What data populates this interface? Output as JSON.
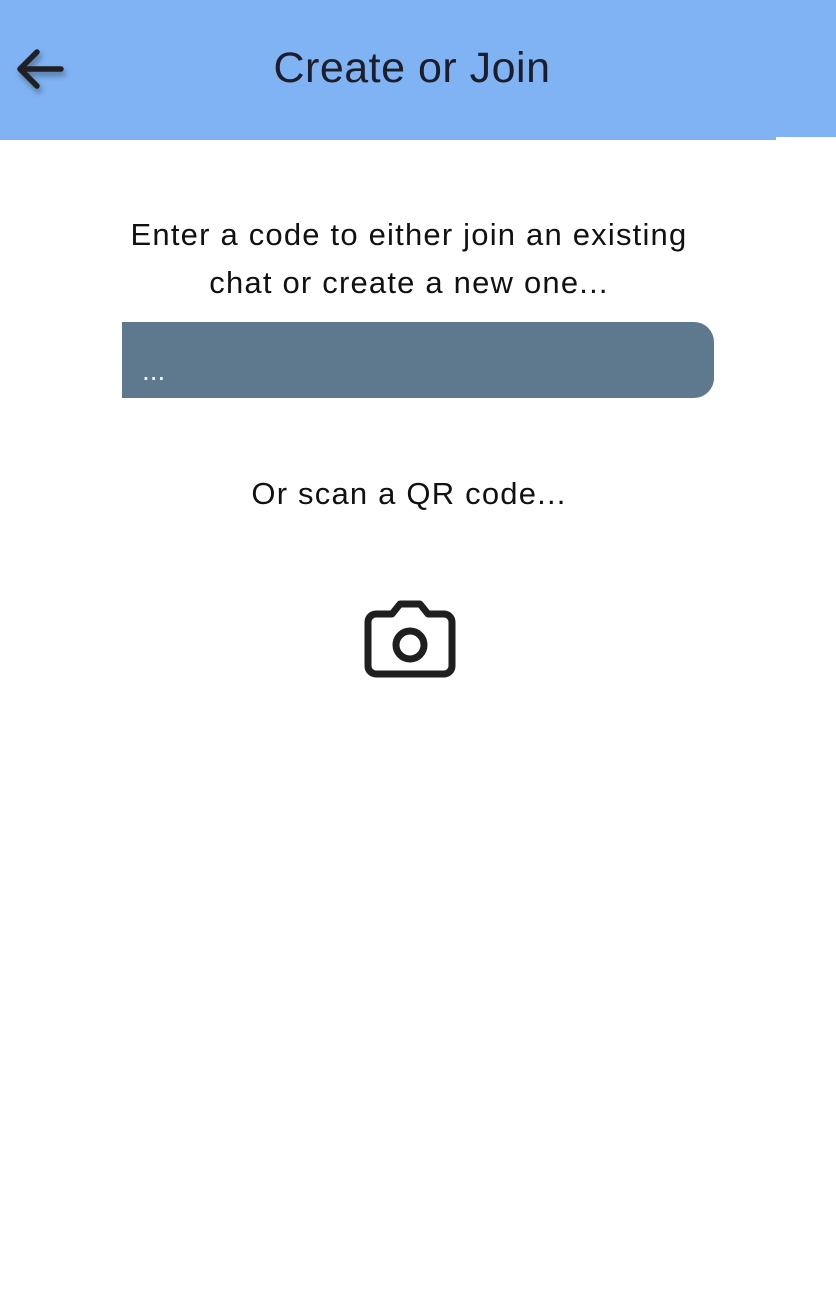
{
  "app_bar": {
    "title": "Create or Join",
    "back_icon": "arrow-left-icon",
    "color": "#80b3f3"
  },
  "main": {
    "instructions": "Enter a code to either join an existing chat or create a new one...",
    "code_input": {
      "placeholder": "...",
      "value": "",
      "background": "#5e798d"
    },
    "scan_label": "Or scan a QR code...",
    "camera_icon": "camera-icon"
  }
}
